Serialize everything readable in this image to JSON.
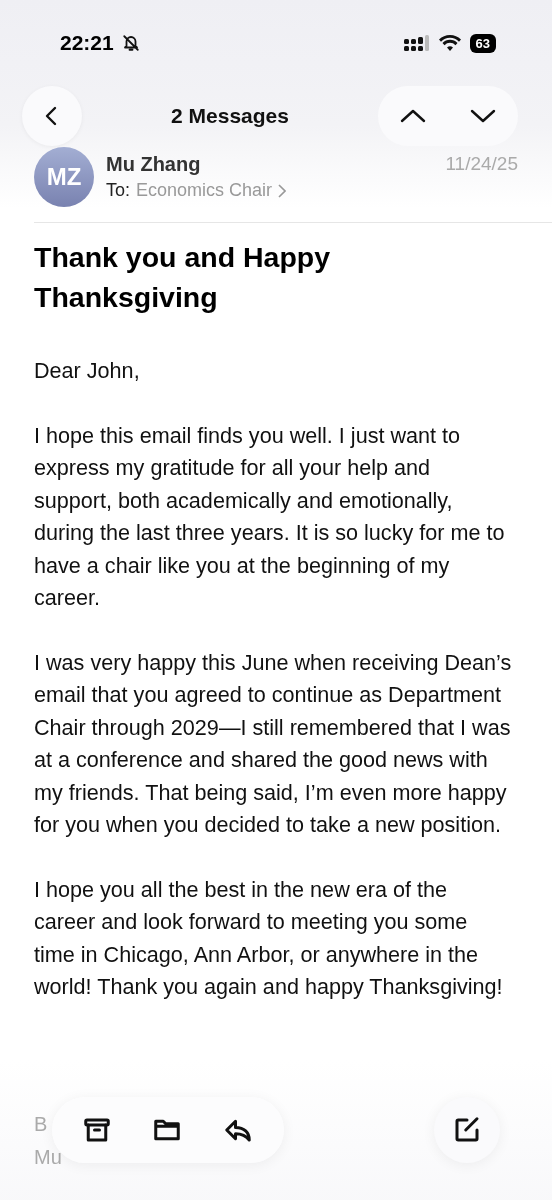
{
  "status_bar": {
    "time": "22:21",
    "battery": "63"
  },
  "nav": {
    "title": "2 Messages"
  },
  "message": {
    "avatar_initials": "MZ",
    "sender": "Mu Zhang",
    "date": "11/24/25",
    "to_label": "To:",
    "recipient": "Economics Chair",
    "subject": "Thank you and Happy Thanksgiving",
    "paragraphs": [
      "Dear John,",
      "I hope this email finds you well. I just want to express my gratitude for all your help and support, both academically and emotionally, during the last three years. It is so lucky for me to have a chair like you at the beginning of my career.",
      "I was very happy this June when receiving Dean’s email that you agreed to continue as Department Chair through 2029—I still remembered that I was at a conference and shared the good news with my friends. That being said, I’m even more happy for you when you decided to take a new position.",
      "I hope you all the best in the new era of the career and look forward to meeting you some time in Chicago, Ann Arbor, or anywhere in the world! Thank you again and happy Thanksgiving!"
    ],
    "signature": [
      "B",
      "Mu"
    ]
  }
}
